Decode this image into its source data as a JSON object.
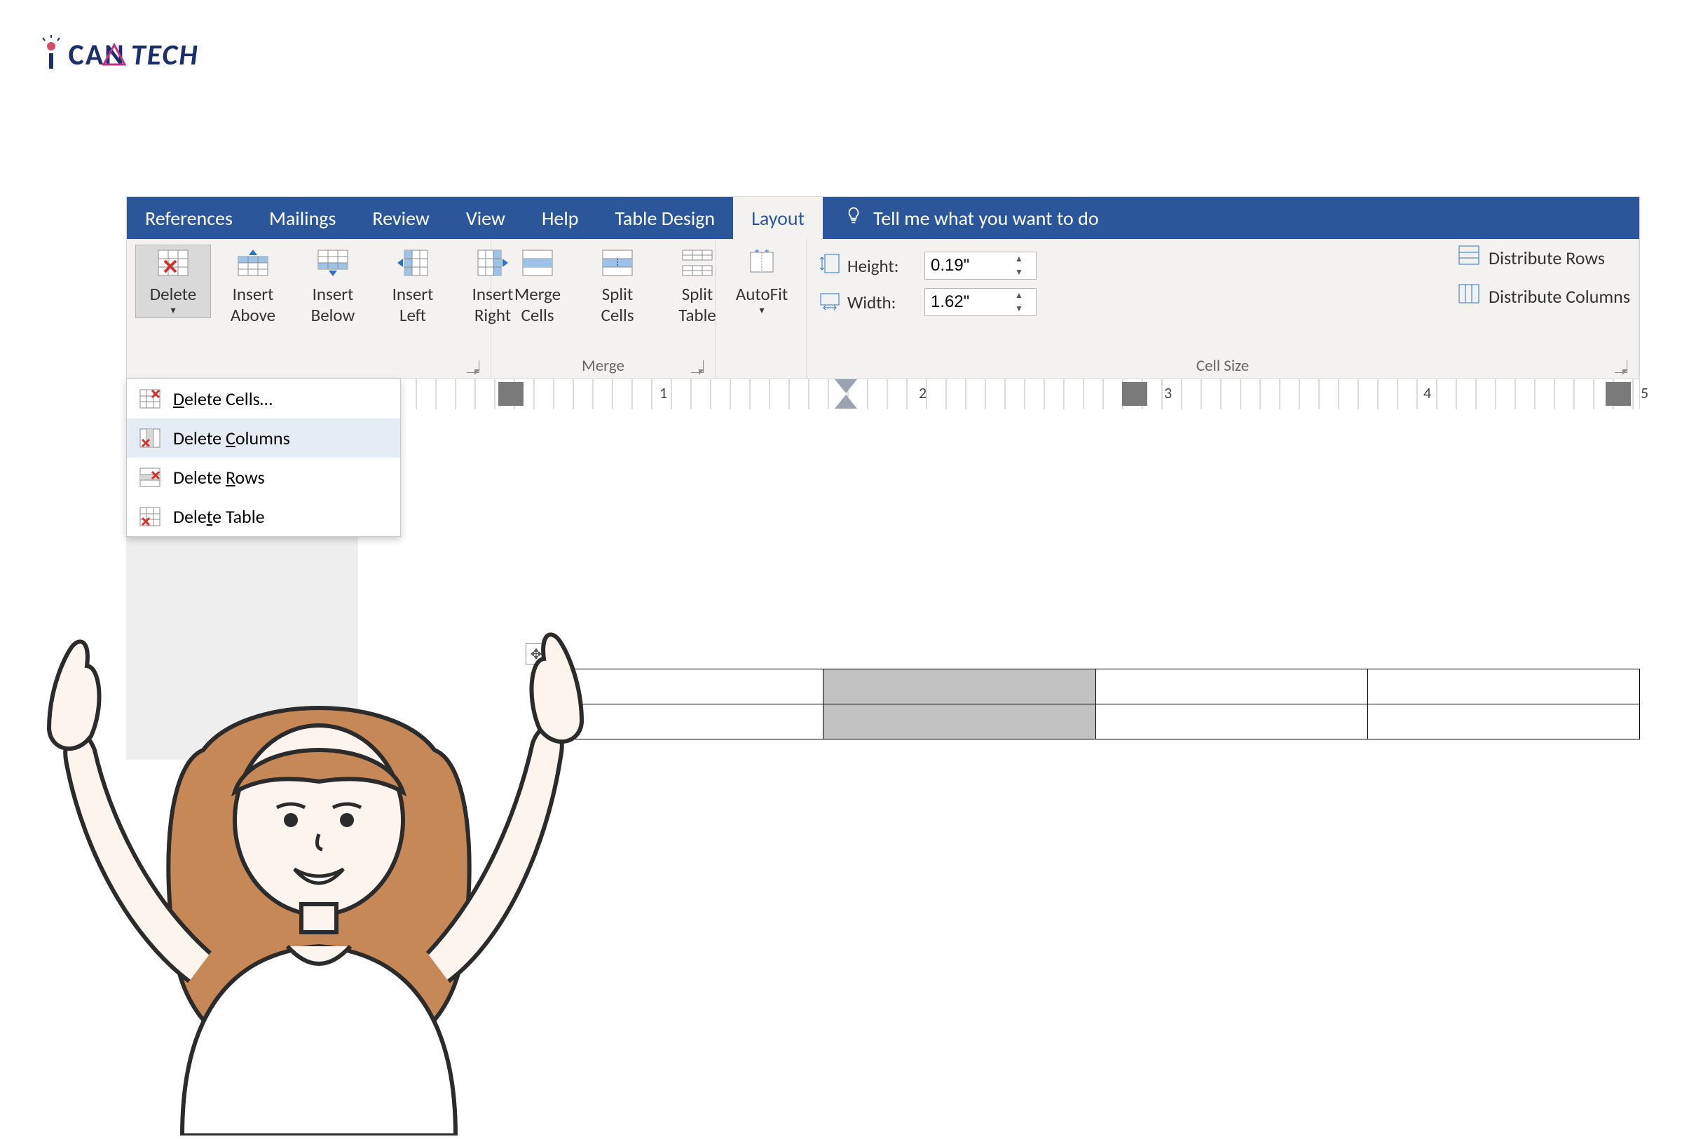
{
  "logo": {
    "text_left": "CAN",
    "text_right": "TECH"
  },
  "tabs": {
    "references": "References",
    "mailings": "Mailings",
    "review": "Review",
    "view": "View",
    "help": "Help",
    "table_design": "Table Design",
    "layout": "Layout",
    "tell_me": "Tell me what you want to do"
  },
  "ribbon": {
    "delete": "Delete",
    "insert_above": "Insert Above",
    "insert_below": "Insert Below",
    "insert_left": "Insert Left",
    "insert_right": "Insert Right",
    "merge_cells": "Merge Cells",
    "split_cells": "Split Cells",
    "split_table": "Split Table",
    "autofit": "AutoFit",
    "height_label": "Height:",
    "height_value": "0.19\"",
    "width_label": "Width:",
    "width_value": "1.62\"",
    "dist_rows": "Distribute Rows",
    "dist_cols": "Distribute Columns",
    "merge_group": "Merge",
    "cellsize_group": "Cell Size"
  },
  "menu": {
    "delete_cells": "Delete Cells…",
    "delete_columns": "Delete Columns",
    "delete_rows": "Delete Rows",
    "delete_table": "Delete Table"
  },
  "ruler": {
    "n1": "1",
    "n2": "2",
    "n3": "3",
    "n4": "4",
    "n5": "5"
  },
  "table": {
    "rows": 2,
    "cols": 4,
    "selected_col_index": 1
  }
}
